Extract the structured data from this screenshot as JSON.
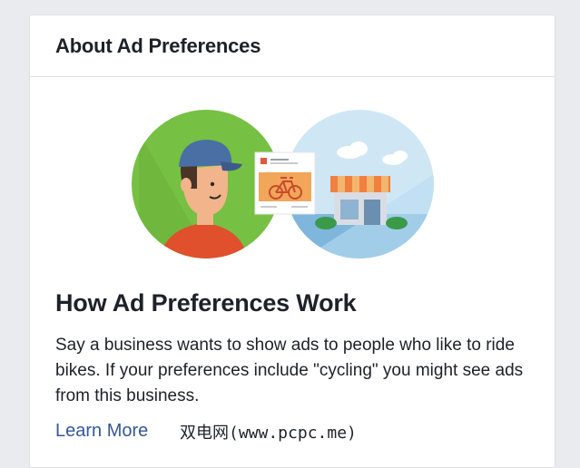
{
  "card": {
    "title": "About Ad Preferences",
    "heading": "How Ad Preferences Work",
    "body": "Say a business wants to show ads to people who like to ride bikes. If your preferences include \"cycling\" you might see ads from this business.",
    "link_label": "Learn More"
  },
  "illustration": {
    "left_circle_color": "#76c043",
    "right_circle_color": "#cfe6f5",
    "cap_color": "#4a6fa5",
    "shirt_color": "#e0502c",
    "ad_banner_color": "#f2a65a",
    "awning_color": "#f08040",
    "icons": [
      "person-icon",
      "ad-card-icon",
      "bicycle-icon",
      "storefront-icon",
      "cloud-icon"
    ]
  },
  "watermark": "双电网(www.pcpc.me)",
  "colors": {
    "page_bg": "#e9ebee",
    "text": "#1d2129",
    "link": "#365899"
  }
}
